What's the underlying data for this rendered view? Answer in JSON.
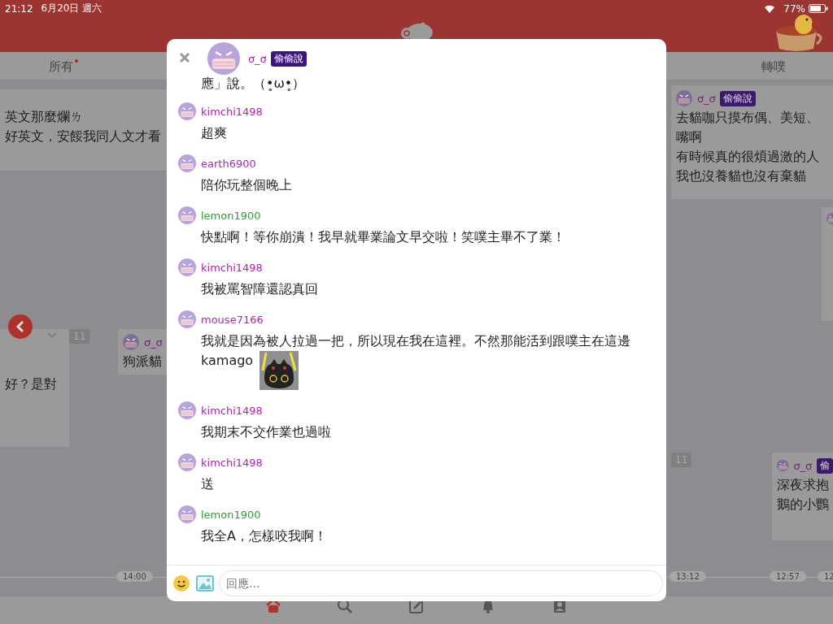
{
  "status_bar": {
    "time": "21:12",
    "date": "6月20日 週六",
    "battery": "77%"
  },
  "tabs": [
    {
      "label": "所有",
      "selected": false,
      "unread": true
    },
    {
      "label": "轉噗",
      "selected": false,
      "unread": false
    }
  ],
  "timeline": {
    "cards": [
      {
        "kind": "text",
        "lines": [
          "英文那麼爛ㄌ",
          "好英文，安餒我同人文才看"
        ]
      },
      {
        "kind": "collapsed",
        "lines": [
          "好？是對"
        ]
      },
      {
        "kind": "post",
        "author": "ơ_ơ",
        "lines": [
          "狗派貓"
        ]
      },
      {
        "kind": "post",
        "author": "ơ_ơ",
        "badge": "偷偷說",
        "lines": [
          "去貓咖只摸布偶、美短、",
          "嘴啊",
          "有時候真的很煩過激的人",
          "我也沒養貓也沒有棄貓"
        ]
      },
      {
        "kind": "image"
      },
      {
        "kind": "post",
        "author": "ơ_ơ",
        "badge": "偷",
        "lines": [
          "深夜求抱",
          "鵝的小鸚"
        ]
      }
    ],
    "counts": [
      "11",
      "11"
    ],
    "times": [
      "14:00",
      "13:12",
      "12:57",
      "12"
    ]
  },
  "modal": {
    "plurk": {
      "author": "ơ_ơ",
      "badge": "偷偷說",
      "text": "應」說。（•̥ω•̥）"
    },
    "responses": [
      {
        "user": "kimchi1498",
        "color": "#b41cb4",
        "text": "超爽"
      },
      {
        "user": "earth6900",
        "color": "#9c2cb8",
        "text": "陪你玩整個晚上"
      },
      {
        "user": "lemon1900",
        "color": "#2e9e2e",
        "text": "快點啊！等你崩潰！我早就畢業論文早交啦！笑噗主畢不了業！"
      },
      {
        "user": "kimchi1498",
        "color": "#b41cb4",
        "text": "我被罵智障還認真回"
      },
      {
        "user": "mouse7166",
        "color": "#b41cb4",
        "text": "我就是因為被人拉過一把，所以現在我在這裡。不然那能活到跟噗主在這邊kamago",
        "sticker": true
      },
      {
        "user": "kimchi1498",
        "color": "#b41cb4",
        "text": "我期末不交作業也過啦"
      },
      {
        "user": "kimchi1498",
        "color": "#b41cb4",
        "text": "送"
      },
      {
        "user": "lemon1900",
        "color": "#2e9e2e",
        "text": "我全A，怎樣咬我啊！"
      }
    ],
    "reply": {
      "placeholder": "回應..."
    }
  },
  "bottom_nav": [
    {
      "kind": "home",
      "selected": true
    },
    {
      "kind": "search",
      "selected": false
    },
    {
      "kind": "edit",
      "selected": false
    },
    {
      "kind": "bell",
      "selected": false
    },
    {
      "kind": "profile",
      "selected": false
    }
  ]
}
